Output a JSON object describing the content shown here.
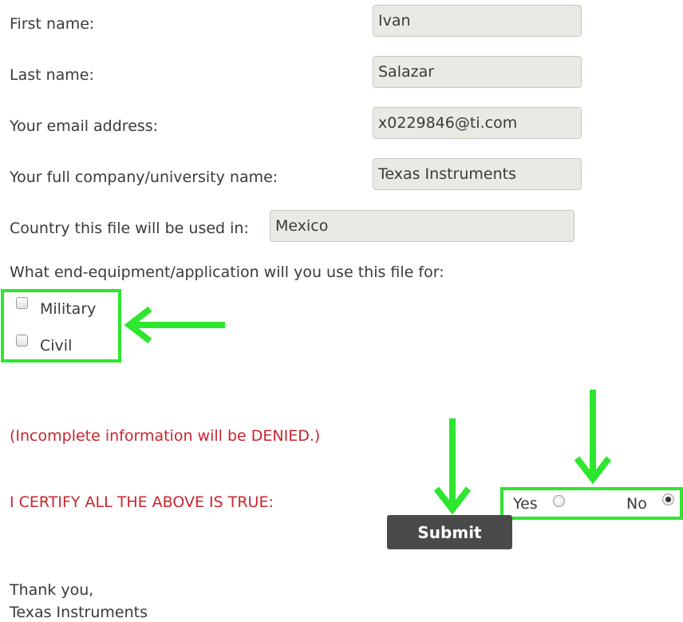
{
  "form": {
    "first_name": {
      "label": "First name:",
      "value": "Ivan"
    },
    "last_name": {
      "label": "Last name:",
      "value": "Salazar"
    },
    "email": {
      "label": "Your email address:",
      "value": "x0229846@ti.com"
    },
    "company": {
      "label": "Your full company/university name:",
      "value": "Texas Instruments"
    },
    "country": {
      "label": "Country this file will be used in:",
      "value": "Mexico"
    },
    "end_equipment": {
      "question": "What end-equipment/application will you use this file for:",
      "options": [
        {
          "label": "Military",
          "checked": false
        },
        {
          "label": "Civil",
          "checked": false
        }
      ]
    },
    "warning": "(Incomplete information will be DENIED.)",
    "certify": {
      "label": "I CERTIFY ALL THE ABOVE IS TRUE:",
      "yes_label": "Yes",
      "no_label": "No",
      "selected": "No"
    },
    "submit_label": "Submit",
    "closing": {
      "line1": "Thank you,",
      "line2": "Texas Instruments"
    }
  },
  "colors": {
    "highlight": "#2ee62e",
    "warning_red": "#c8252f",
    "field_bg": "#ebe9e4",
    "submit_bg": "#4a4a4a"
  }
}
